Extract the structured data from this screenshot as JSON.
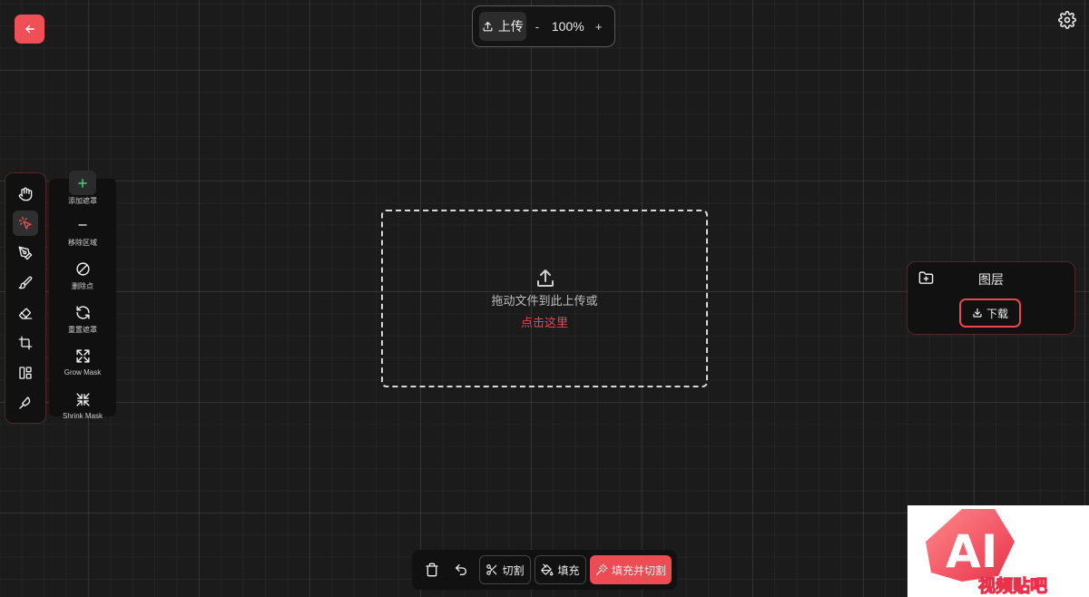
{
  "colors": {
    "accent": "#ef4f57",
    "link": "#e8474f",
    "add_icon": "#4cd07a",
    "background": "#1c1b1c"
  },
  "topbar": {
    "upload_label": "上传",
    "zoom_out": "-",
    "zoom_level": "100%",
    "zoom_in": "+"
  },
  "tools": [
    {
      "name": "hand-icon"
    },
    {
      "name": "magic-select-icon",
      "active": true
    },
    {
      "name": "pen-icon"
    },
    {
      "name": "brush-icon"
    },
    {
      "name": "eraser-icon"
    },
    {
      "name": "crop-icon"
    },
    {
      "name": "layout-icon"
    },
    {
      "name": "knife-icon"
    }
  ],
  "mask_panel": {
    "items": [
      {
        "label": "添加遮罩",
        "icon": "plus-icon"
      },
      {
        "label": "移除区域",
        "icon": "minus-icon"
      },
      {
        "label": "删除点",
        "icon": "no-entry-icon"
      },
      {
        "label": "重置遮罩",
        "icon": "refresh-icon"
      },
      {
        "label": "Grow Mask",
        "icon": "expand-icon"
      },
      {
        "label": "Shrink Mask",
        "icon": "shrink-icon"
      }
    ]
  },
  "dropzone": {
    "text": "拖动文件到此上传或",
    "link": "点击这里"
  },
  "layers": {
    "title": "图层",
    "download_label": "下载"
  },
  "bottombar": {
    "cut_label": "切割",
    "fill_label": "填充",
    "fill_cut_label": "填充并切割"
  },
  "watermark": {
    "text": "AI 视频贴吧"
  }
}
